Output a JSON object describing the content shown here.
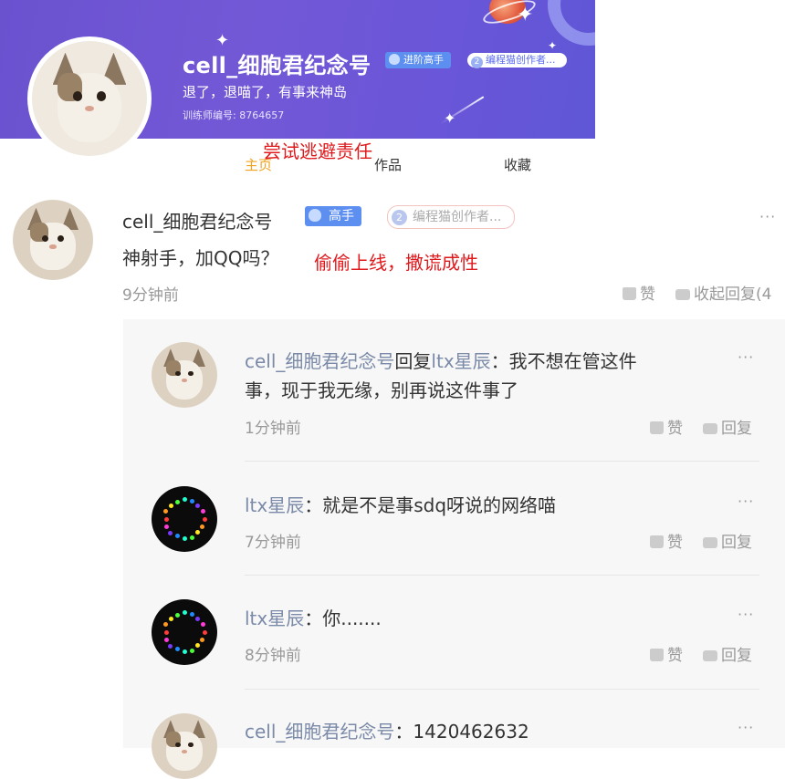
{
  "profile": {
    "username": "cell_细胞君纪念号",
    "badge_level": "进阶高手",
    "badge_creator": "编程猫创作者...",
    "badge_creator_num": "2",
    "bio": "退了，退喵了，有事来神岛",
    "trainer_id": "训练师编号: 8764657"
  },
  "tabs": [
    {
      "label": "主页",
      "active": true
    },
    {
      "label": "作品",
      "active": false
    },
    {
      "label": "收藏",
      "active": false
    }
  ],
  "annotations": {
    "note1": "尝试逃避责任",
    "note2": "偷偷上线，撒谎成性"
  },
  "comment": {
    "author": "cell_细胞君纪念号",
    "badge_level": "高手",
    "badge_creator": "编程猫创作者...",
    "badge_creator_num": "2",
    "text": "神射手，加QQ吗？",
    "time": "9分钟前",
    "like_label": "赞",
    "collapse_label": "收起回复(4",
    "more": "···"
  },
  "replies": [
    {
      "author": "cell_细胞君纪念号",
      "reply_word": "回复",
      "target": "ltx星辰",
      "line1": "：我不想在管这件",
      "line2": "事，现于我无缘，别再说这件事了",
      "time": "1分钟前",
      "like_label": "赞",
      "reply_label": "回复",
      "more": "···",
      "avatar": "cat"
    },
    {
      "author": "ltx星辰",
      "text": "：就是不是事sdq呀说的网络喵",
      "time": "7分钟前",
      "like_label": "赞",
      "reply_label": "回复",
      "more": "···",
      "avatar": "dots"
    },
    {
      "author": "ltx星辰",
      "text": "：你.......",
      "time": "8分钟前",
      "like_label": "赞",
      "reply_label": "回复",
      "more": "···",
      "avatar": "dots"
    },
    {
      "author": "cell_细胞君纪念号",
      "text": "：1420462632",
      "more": "···",
      "avatar": "cat"
    }
  ],
  "colors": {
    "banner": "#6a52cf",
    "active_tab": "#f0a31c",
    "annotation": "#e0191d",
    "reply_name": "#7a8aa8",
    "badge": "#5d8ff0"
  }
}
